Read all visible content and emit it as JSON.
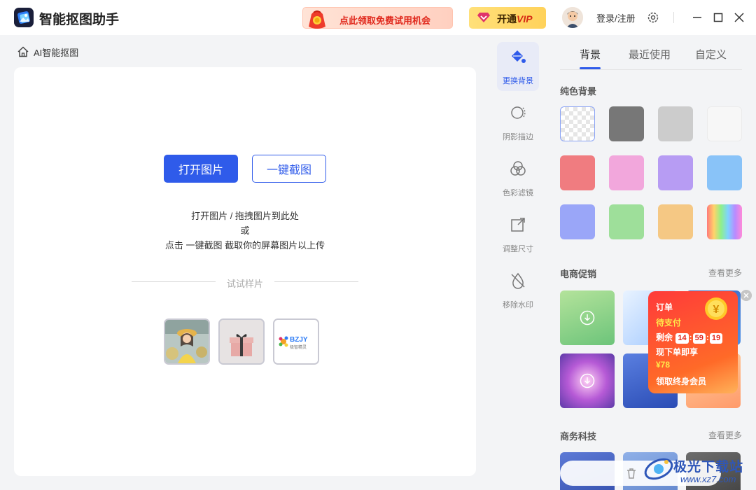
{
  "app": {
    "title": "智能抠图助手"
  },
  "titlebar": {
    "promo_text": "点此领取免费试用机会",
    "vip_prefix": "开通",
    "vip_suffix": "VIP",
    "login_text": "登录/注册"
  },
  "breadcrumb": {
    "label": "AI智能抠图"
  },
  "canvas": {
    "open_button": "打开图片",
    "screenshot_button": "一键截图",
    "hint_line1": "打开图片 / 拖拽图片到此处",
    "hint_line2": "或",
    "hint_line3": "点击 一键截图 截取你的屏幕图片以上传",
    "try_samples": "试试样片"
  },
  "tools": [
    {
      "label": "更换背景",
      "icon": "paint-bucket-icon",
      "active": true
    },
    {
      "label": "阴影描边",
      "icon": "shadow-outline-icon",
      "active": false
    },
    {
      "label": "色彩滤镜",
      "icon": "color-filter-icon",
      "active": false
    },
    {
      "label": "调整尺寸",
      "icon": "resize-icon",
      "active": false
    },
    {
      "label": "移除水印",
      "icon": "remove-watermark-icon",
      "active": false
    }
  ],
  "panel": {
    "tabs": [
      "背景",
      "最近使用",
      "自定义"
    ],
    "solid_title": "纯色背景",
    "ecommerce_title": "电商促销",
    "business_title": "商务科技",
    "see_more": "查看更多",
    "swatch_colors": [
      "transparent",
      "#777777",
      "#cccccc",
      "#f7f7f7",
      "#f07c80",
      "#f2a7dc",
      "#b79cf3",
      "#89c3f8",
      "#9aa6f8",
      "#9edf9a",
      "#f5c884",
      "rainbow"
    ]
  },
  "popup": {
    "line1": "订单",
    "line2": "待支付",
    "remain": "剩余",
    "hours": "14",
    "minutes": "59",
    "seconds": "19",
    "line4": "现下单即享",
    "price": "¥78",
    "line6": "领取终身会员",
    "coin_symbol": "¥"
  },
  "watermark": {
    "name": "极光下载站",
    "url": "www.xz7.com"
  },
  "sample_logo_text": "BZJY",
  "sample_logo_sub": "极智精灵"
}
